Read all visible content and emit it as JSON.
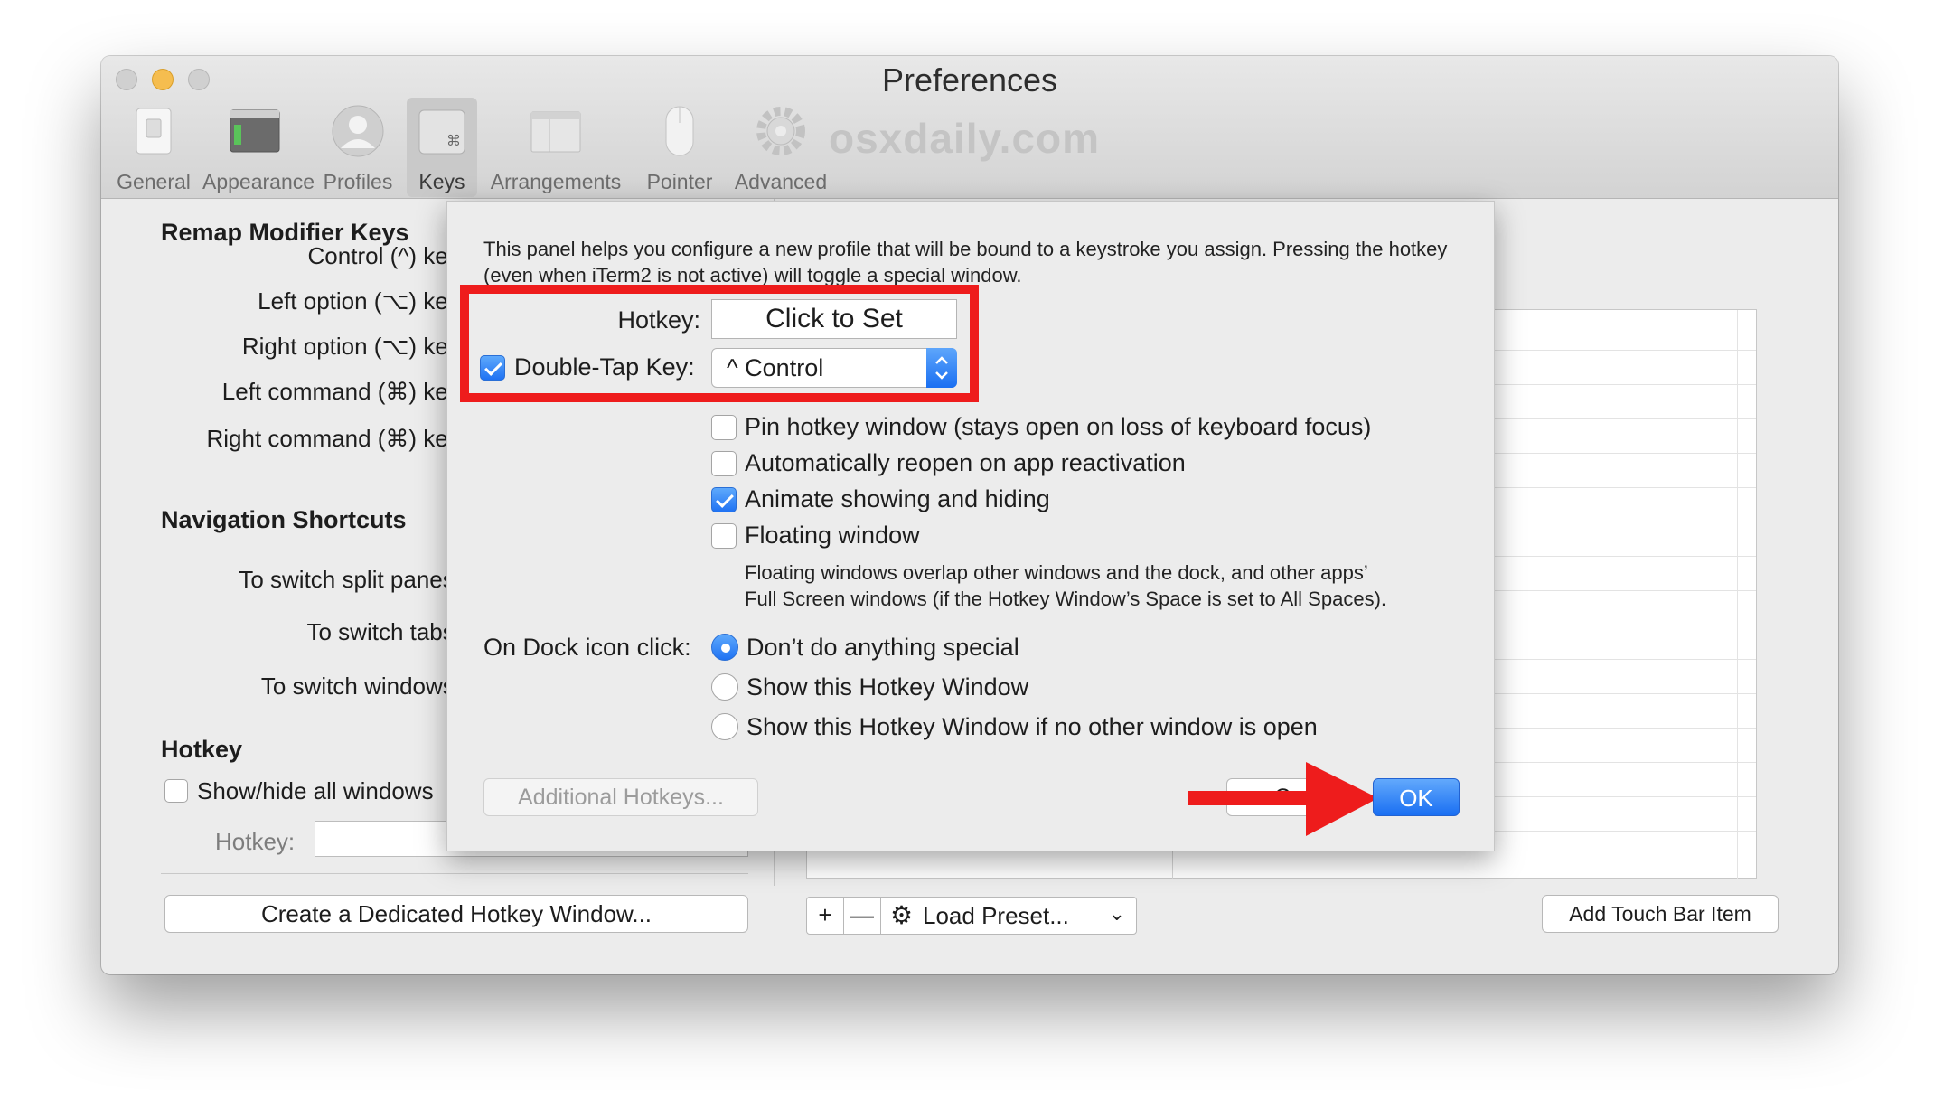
{
  "window": {
    "title": "Preferences",
    "watermark": "osxdaily.com"
  },
  "toolbar": {
    "tabs": [
      {
        "label": "General",
        "icon": "switch-icon"
      },
      {
        "label": "Appearance",
        "icon": "window-icon"
      },
      {
        "label": "Profiles",
        "icon": "person-icon"
      },
      {
        "label": "Keys",
        "icon": "command-key-icon",
        "selected": true
      },
      {
        "label": "Arrangements",
        "icon": "windows-icon"
      },
      {
        "label": "Pointer",
        "icon": "mouse-icon"
      },
      {
        "label": "Advanced",
        "icon": "gear-icon"
      }
    ]
  },
  "remap": {
    "heading": "Remap Modifier Keys",
    "rows": [
      "Control (^) key:",
      "Left option (⌥) key:",
      "Right option (⌥) key:",
      "Left command (⌘) key:",
      "Right command (⌘) key:"
    ]
  },
  "navigation": {
    "heading": "Navigation Shortcuts",
    "rows": [
      "To switch split panes:",
      "To switch tabs:",
      "To switch windows:"
    ]
  },
  "hotkey_section": {
    "heading": "Hotkey",
    "show_hide_label": "Show/hide all windows",
    "hotkey_label": "Hotkey:",
    "dedicated_button": "Create a Dedicated Hotkey Window..."
  },
  "key_table": {
    "add_symbol": "+",
    "remove_symbol": "—",
    "load_preset": "Load Preset...",
    "touch_bar_button": "Add Touch Bar Item"
  },
  "sheet": {
    "description": "This panel helps you configure a new profile that will be bound to a keystroke you assign. Pressing the hotkey (even when iTerm2 is not active) will toggle a special window.",
    "hotkey_label": "Hotkey:",
    "hotkey_value": "Click to Set",
    "double_tap_label": "Double-Tap Key:",
    "double_tap_checked": true,
    "double_tap_value": "^ Control",
    "options": [
      {
        "label": "Pin hotkey window (stays open on loss of keyboard focus)",
        "checked": false
      },
      {
        "label": "Automatically reopen on app reactivation",
        "checked": false
      },
      {
        "label": "Animate showing and hiding",
        "checked": true
      },
      {
        "label": "Floating window",
        "checked": false
      }
    ],
    "floating_note_1": "Floating windows overlap other windows and the dock, and other apps’",
    "floating_note_2": "Full Screen windows (if the Hotkey Window’s Space is set to All Spaces).",
    "dock_label": "On Dock icon click:",
    "dock_options": [
      {
        "label": "Don’t do anything special",
        "selected": true
      },
      {
        "label": "Show this Hotkey Window",
        "selected": false
      },
      {
        "label": "Show this Hotkey Window if no other window is open",
        "selected": false
      }
    ],
    "additional_button": "Additional Hotkeys...",
    "cancel_button": "C",
    "ok_button": "OK"
  },
  "colors": {
    "accent": "#1f72f3",
    "highlight": "#ee1c1c"
  }
}
